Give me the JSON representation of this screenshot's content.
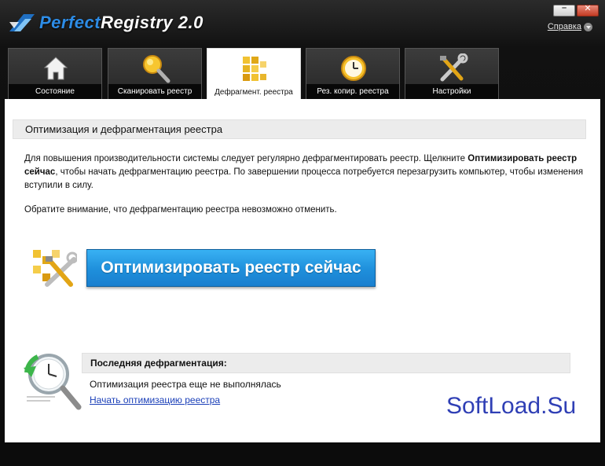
{
  "app": {
    "title_part1": "Perfect",
    "title_part2": "Registry 2.0",
    "help_label": "Справка"
  },
  "window_buttons": {
    "minimize_glyph": "–",
    "close_glyph": "✕"
  },
  "tabs": [
    {
      "label": "Состояние",
      "icon": "home-icon",
      "active": false
    },
    {
      "label": "Сканировать реестр",
      "icon": "magnifier-icon",
      "active": false
    },
    {
      "label": "Дефрагмент. реестра",
      "icon": "defrag-blocks-icon",
      "active": true
    },
    {
      "label": "Рез. копир. реестра",
      "icon": "backup-clock-icon",
      "active": false
    },
    {
      "label": "Настройки",
      "icon": "tools-icon",
      "active": false
    }
  ],
  "main": {
    "section_title": "Оптимизация и дефрагментация реестра",
    "para1_a": "Для повышения производительности системы следует регулярно дефрагментировать реестр. Щелкните ",
    "para1_bold": "Оптимизировать реестр сейчас",
    "para1_b": ", чтобы начать дефрагментацию реестра. По завершении процесса потребуется перезагрузить компьютер, чтобы изменения вступили в силу.",
    "para2": "Обратите внимание, что дефрагментацию реестра невозможно отменить.",
    "optimize_button": "Оптимизировать реестр сейчас",
    "last_defrag_title": "Последняя дефрагментация:",
    "last_defrag_status": "Оптимизация реестра еще не выполнялась",
    "start_link": "Начать оптимизацию реестра"
  },
  "watermark": "SoftLoad.Su",
  "colors": {
    "accent_blue": "#1e8fdb",
    "link_blue": "#1a3fb8",
    "watermark_blue": "#2f3fb5"
  }
}
